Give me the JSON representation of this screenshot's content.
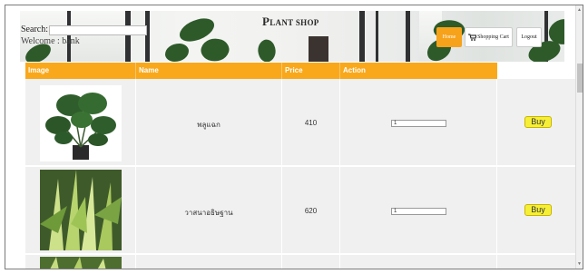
{
  "header": {
    "title_first": "P",
    "title_rest": "LANT SHOP",
    "search_label": "Search:",
    "search_value": "",
    "welcome_text": "Welcome : bank",
    "home_label": "Home",
    "cart_label": "Shopping Cart",
    "logout_label": "Logout"
  },
  "table": {
    "columns": [
      "Image",
      "Name",
      "Price",
      "Action"
    ],
    "rows": [
      {
        "name": "พลูแฉก",
        "price": "410",
        "qty": "1",
        "buy_label": "Buy"
      },
      {
        "name": "วาสนาอธิษฐาน",
        "price": "620",
        "qty": "1",
        "buy_label": "Buy"
      }
    ]
  },
  "colors": {
    "accent_orange": "#f9a81c",
    "buy_yellow": "#f5f037",
    "row_bg": "#f0f0f0"
  }
}
